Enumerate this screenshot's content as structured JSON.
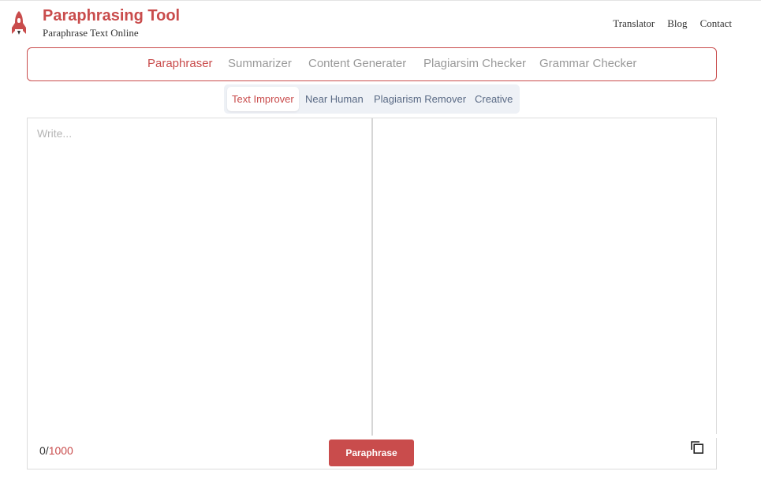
{
  "header": {
    "logo_icon": "rocket-icon",
    "title": "Paraphrasing Tool",
    "subtitle": "Paraphrase Text Online",
    "nav": [
      "Translator",
      "Blog",
      "Contact"
    ]
  },
  "tabs": [
    {
      "label": "Paraphraser",
      "active": true
    },
    {
      "label": "Summarizer",
      "active": false
    },
    {
      "label": "Content Generater",
      "active": false
    },
    {
      "label": "Plagiarsim Checker",
      "active": false
    },
    {
      "label": "Grammar Checker",
      "active": false
    }
  ],
  "modes": [
    {
      "label": "Text Improver",
      "active": true
    },
    {
      "label": "Near Human",
      "active": false
    },
    {
      "label": "Plagiarism Remover",
      "active": false
    },
    {
      "label": "Creative",
      "active": false
    }
  ],
  "editor": {
    "input_value": "",
    "placeholder": "Write...",
    "count_current": "0",
    "count_max": "1000",
    "count_separator": "/",
    "action_label": "Paraphrase",
    "copy_icon": "copy-icon"
  },
  "colors": {
    "accent": "#c94c4c",
    "muted_tab": "#999999",
    "mode_text": "#5a6a85",
    "mode_bg": "#eef1f6"
  }
}
